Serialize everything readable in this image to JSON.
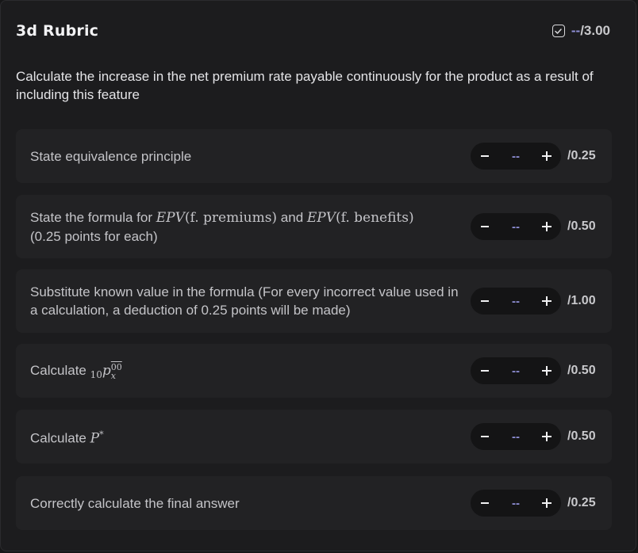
{
  "header": {
    "title": "3d Rubric",
    "score_placeholder": "--",
    "score_total": "/3.00"
  },
  "question": "Calculate the increase in the net premium rate payable continuously for the product as a result of including this feature",
  "criteria": [
    {
      "label": "State equivalence principle",
      "value": "--",
      "max": "/0.25"
    },
    {
      "label_prefix": "State the formula for ",
      "epv1": "EPV",
      "epv1_arg": "(f. premiums)",
      "label_mid": " and ",
      "epv2": "EPV",
      "epv2_arg": "(f. benefits)",
      "label_suffix": "(0.25 points for each)",
      "value": "--",
      "max": "/0.50"
    },
    {
      "label": "Substitute known value in the formula (For every incorrect value used in a calculation, a deduction of 0.25 points will be made)",
      "value": "--",
      "max": "/1.00"
    },
    {
      "label": "Calculate ",
      "math_pre": "10",
      "math_main": "p",
      "math_sup": "00",
      "math_sub": "x",
      "value": "--",
      "max": "/0.50"
    },
    {
      "label": "Calculate ",
      "math_main": "P",
      "math_sup": "*",
      "value": "--",
      "max": "/0.50"
    },
    {
      "label": "Correctly calculate the final answer",
      "value": "--",
      "max": "/0.25"
    }
  ],
  "icons": {
    "check": "checkbox-check-icon",
    "minus": "minus-icon",
    "plus": "plus-icon"
  },
  "colors": {
    "accent": "#8f8fd6",
    "background": "#1c1c1e",
    "card": "#222224"
  }
}
